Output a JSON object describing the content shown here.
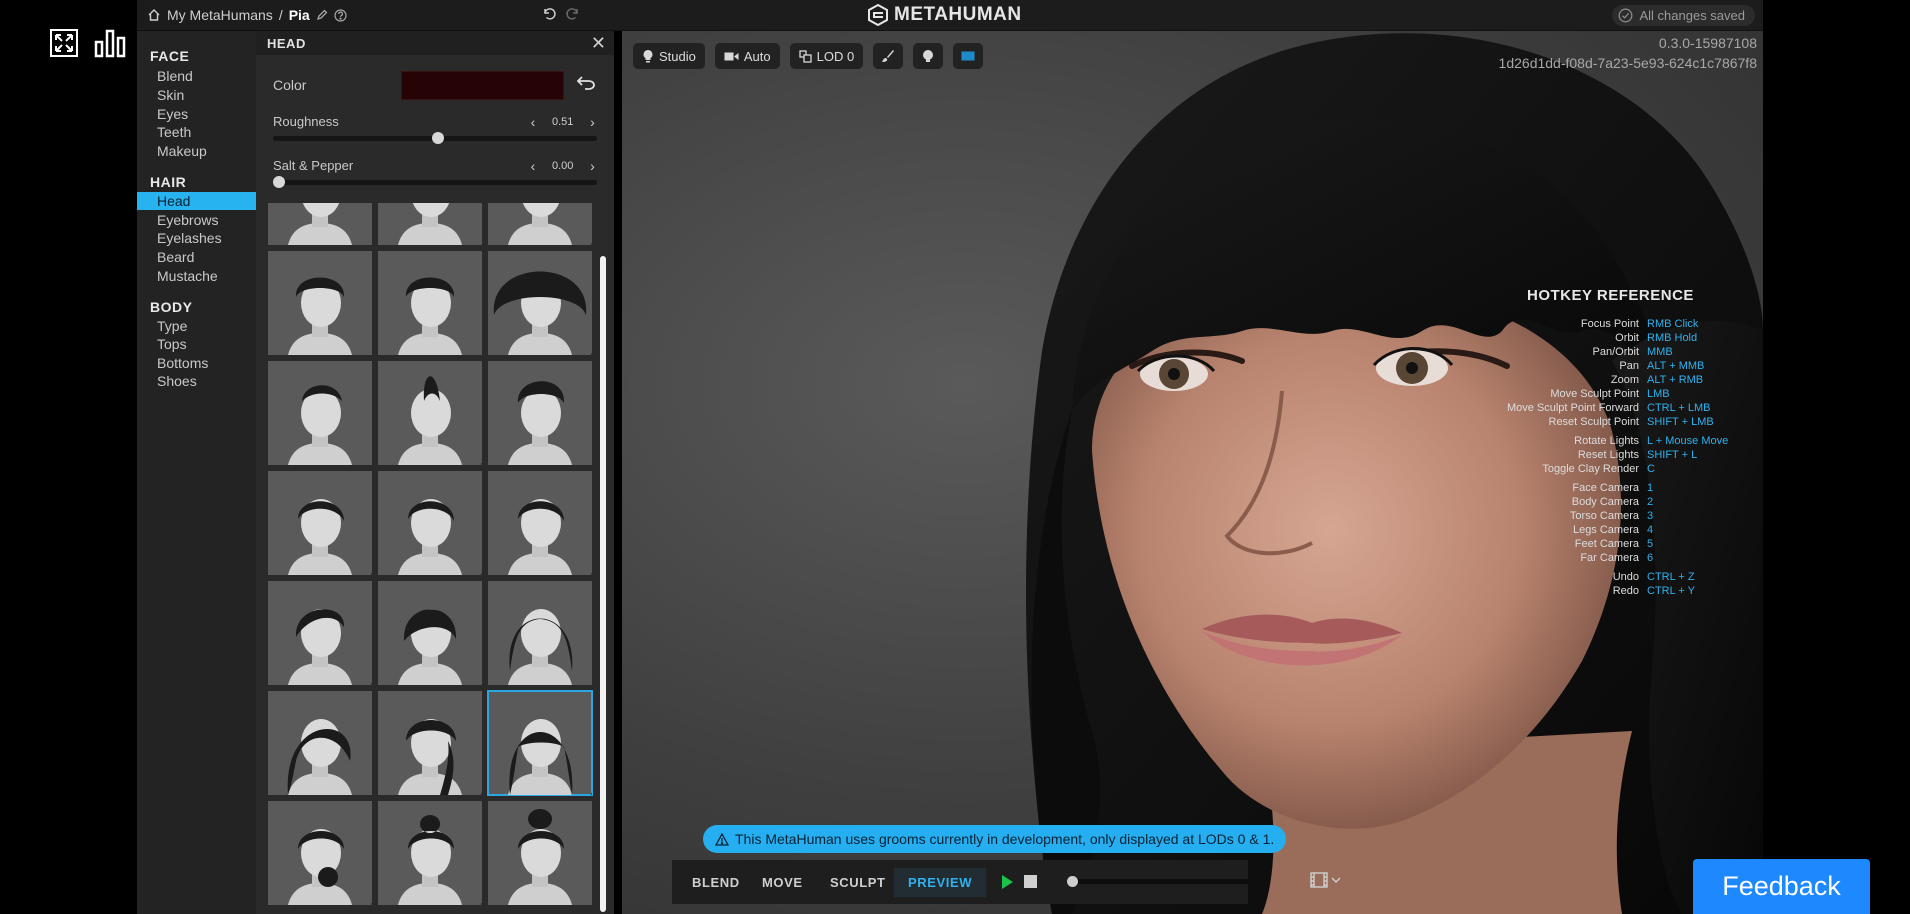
{
  "breadcrumb": {
    "root": "My MetaHumans",
    "separator": "/",
    "current": "Pia"
  },
  "brand": {
    "logo_text": "METAHUMAN"
  },
  "save_status": "All changes saved",
  "nav": {
    "sections": [
      {
        "title": "FACE",
        "items": [
          "Blend",
          "Skin",
          "Eyes",
          "Teeth",
          "Makeup"
        ]
      },
      {
        "title": "HAIR",
        "items": [
          "Head",
          "Eyebrows",
          "Eyelashes",
          "Beard",
          "Mustache"
        ]
      },
      {
        "title": "BODY",
        "items": [
          "Type",
          "Tops",
          "Bottoms",
          "Shoes"
        ]
      }
    ],
    "active_item": "Head"
  },
  "panel": {
    "title": "HEAD",
    "color_label": "Color",
    "color_value": "#260405",
    "roughness": {
      "label": "Roughness",
      "value": "0.51",
      "level": 0.51
    },
    "salt_pepper": {
      "label": "Salt & Pepper",
      "value": "0.00",
      "level": 0.0
    },
    "grid": {
      "tiles": [
        {
          "style": "cropped",
          "warning": false
        },
        {
          "style": "cropped",
          "warning": false
        },
        {
          "style": "cropped",
          "warning": true
        },
        {
          "style": "curly-short",
          "warning": false
        },
        {
          "style": "curly-short",
          "warning": false
        },
        {
          "style": "afro",
          "warning": true
        },
        {
          "style": "undercut",
          "warning": false
        },
        {
          "style": "mohawk",
          "warning": true
        },
        {
          "style": "pompadour",
          "warning": false
        },
        {
          "style": "short",
          "warning": true
        },
        {
          "style": "short",
          "warning": true
        },
        {
          "style": "short",
          "warning": true
        },
        {
          "style": "side-swept",
          "warning": true
        },
        {
          "style": "messy-fringe",
          "warning": false
        },
        {
          "style": "bob",
          "warning": false
        },
        {
          "style": "long-side",
          "warning": false
        },
        {
          "style": "braided",
          "warning": true
        },
        {
          "style": "long-bangs",
          "warning": true,
          "selected": true
        },
        {
          "style": "low-bun",
          "warning": true
        },
        {
          "style": "top-bun",
          "warning": true
        },
        {
          "style": "high-bun",
          "warning": false
        }
      ]
    }
  },
  "viewport": {
    "tools": [
      {
        "icon": "lightbulb-icon",
        "label": "Studio"
      },
      {
        "icon": "camera-icon",
        "label": "Auto"
      },
      {
        "icon": "lod-icon",
        "label": "LOD 0"
      },
      {
        "icon": "brush-icon",
        "label": ""
      },
      {
        "icon": "clay-head-icon",
        "label": ""
      },
      {
        "icon": "screen-icon",
        "label": ""
      }
    ],
    "version": "0.3.0-15987108",
    "id": "1d26d1dd-f08d-7a23-5e93-624c1c7867f8",
    "hotkeys": {
      "title": "HOTKEY REFERENCE",
      "rows": [
        {
          "action": "Focus Point",
          "key": "RMB Click"
        },
        {
          "action": "Orbit",
          "key": "RMB Hold"
        },
        {
          "action": "Pan/Orbit",
          "key": "MMB"
        },
        {
          "action": "Pan",
          "key": "ALT + MMB"
        },
        {
          "action": "Zoom",
          "key": "ALT + RMB"
        },
        {
          "action": "Move Sculpt Point",
          "key": "LMB"
        },
        {
          "action": "Move Sculpt Point Forward",
          "key": "CTRL + LMB"
        },
        {
          "action": "Reset Sculpt Point",
          "key": "SHIFT + LMB"
        },
        {
          "action": "Rotate Lights",
          "key": "L + Mouse Move"
        },
        {
          "action": "Reset Lights",
          "key": "SHIFT + L"
        },
        {
          "action": "Toggle Clay Render",
          "key": "C"
        },
        {
          "action": "Face Camera",
          "key": "1"
        },
        {
          "action": "Body Camera",
          "key": "2"
        },
        {
          "action": "Torso Camera",
          "key": "3"
        },
        {
          "action": "Legs Camera",
          "key": "4"
        },
        {
          "action": "Feet Camera",
          "key": "5"
        },
        {
          "action": "Far Camera",
          "key": "6"
        },
        {
          "action": "Undo",
          "key": "CTRL + Z"
        },
        {
          "action": "Redo",
          "key": "CTRL + Y"
        }
      ]
    },
    "notice": "This MetaHuman uses grooms currently in development, only displayed at LODs 0 & 1.",
    "modes": [
      "BLEND",
      "MOVE",
      "SCULPT",
      "PREVIEW"
    ],
    "active_mode": "PREVIEW",
    "timeline_level": 0.0
  },
  "feedback_label": "Feedback",
  "colors": {
    "accent": "#26b3f0",
    "feedback": "#1e88ff",
    "panel": "#2a2a2a"
  }
}
